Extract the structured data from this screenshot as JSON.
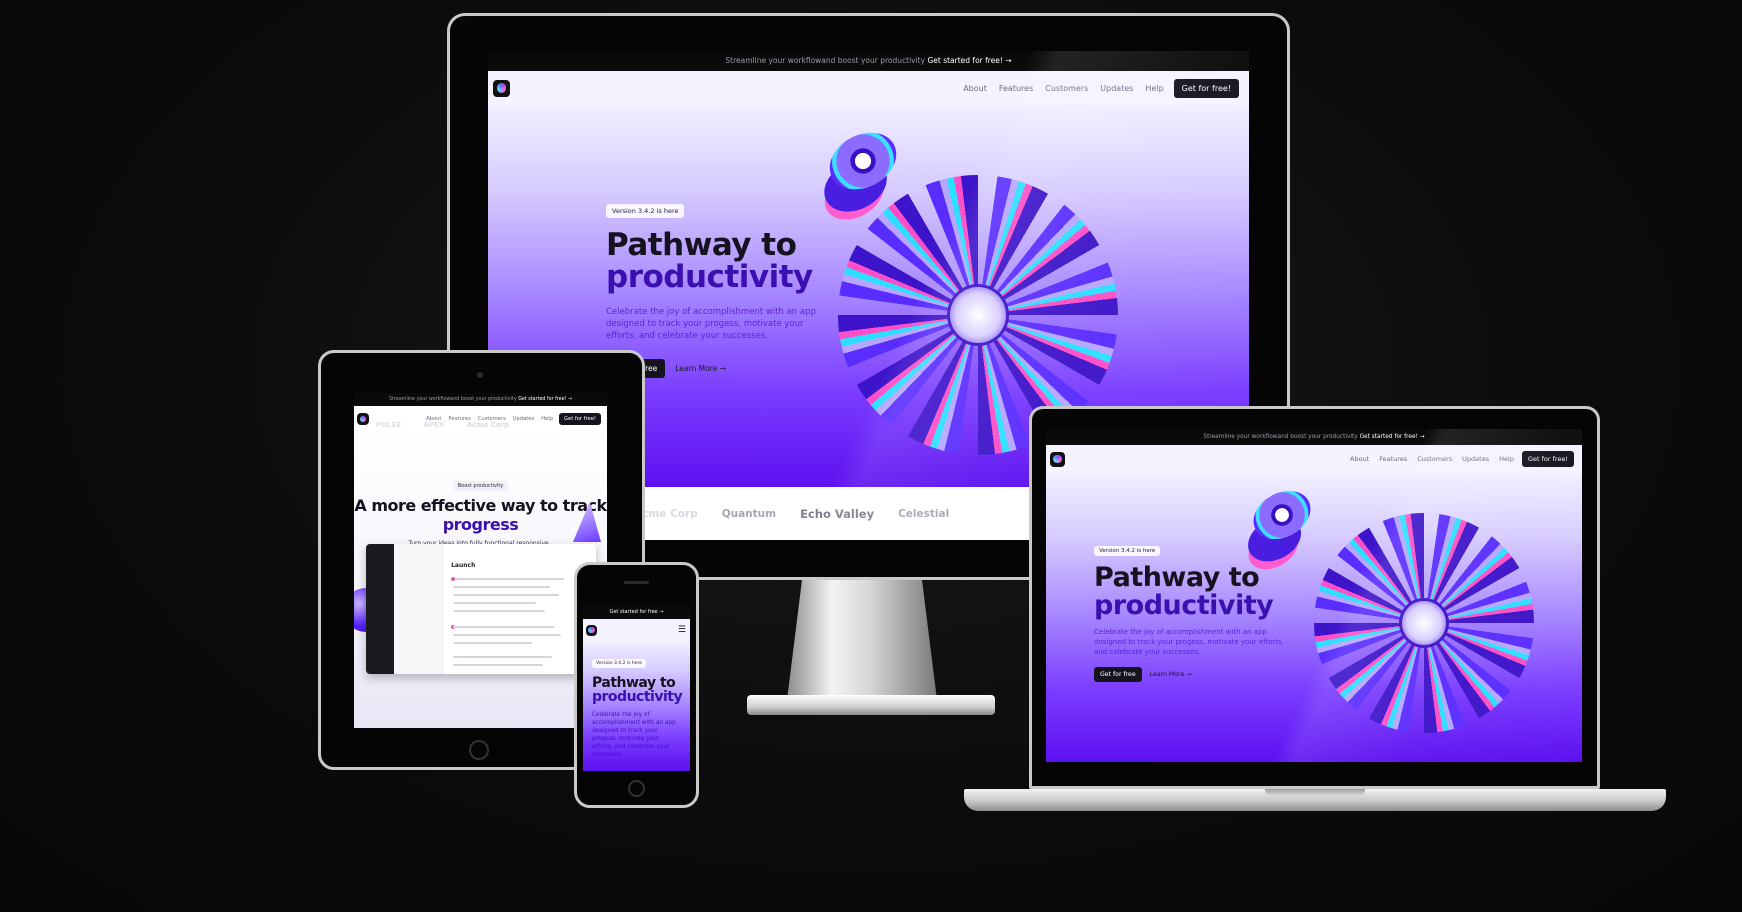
{
  "site": {
    "announcement": {
      "text": "Streamline your workflowand boost your productivity",
      "cta": "Get started for free! →"
    },
    "announcement_mobile": {
      "cta": "Get started for free  →"
    },
    "nav": {
      "links": [
        "About",
        "Features",
        "Customers",
        "Updates",
        "Help"
      ],
      "cta": "Get for free!"
    },
    "hero": {
      "badge": "Version 3.4.2 is here",
      "title_line1": "Pathway to",
      "title_line2": "productivity",
      "description": "Celebrate the joy of accomplishment with an app designed to track your progess, motivate your efforts, and celebrate your successes.",
      "primary_cta": "Get for free",
      "secondary_cta": "Learn More →"
    },
    "logos": [
      "Acme Corp",
      "Quantum",
      "Echo Valley",
      "Celestial"
    ],
    "tablet_hero": {
      "badge": "Boost productivity",
      "title_line1": "A more effective way to track",
      "title_line2": "progress",
      "subtitle": "Turn your ideas into fully functional,responsive..",
      "dashboard_heading": "Launch"
    },
    "tablet_logos": [
      "PULSE",
      "APEX",
      "Acme Corp"
    ]
  },
  "colors": {
    "accent_purple": "#5c10ef",
    "dark_button": "#15131d",
    "background": "#0c0c0c"
  }
}
